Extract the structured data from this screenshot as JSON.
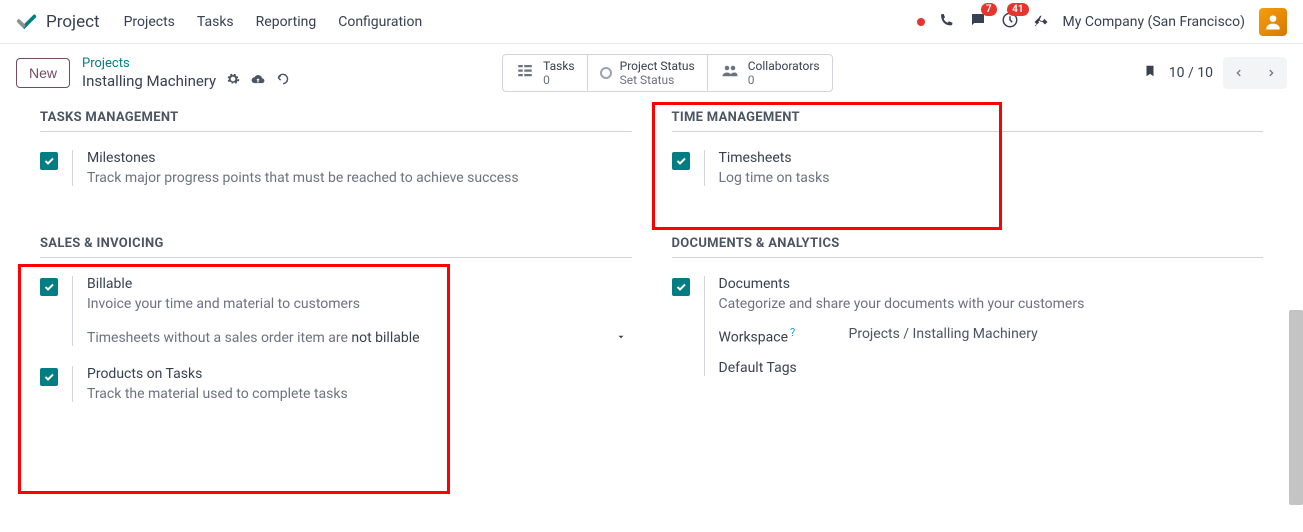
{
  "header": {
    "app_name": "Project",
    "menu": [
      "Projects",
      "Tasks",
      "Reporting",
      "Configuration"
    ],
    "chat_badge": "7",
    "activity_badge": "41",
    "company": "My Company (San Francisco)"
  },
  "controlbar": {
    "new_label": "New",
    "breadcrumb_parent": "Projects",
    "breadcrumb_current": "Installing Machinery",
    "stat_tasks_label": "Tasks",
    "stat_tasks_value": "0",
    "stat_status_label": "Project Status",
    "stat_status_value": "Set Status",
    "stat_collab_label": "Collaborators",
    "stat_collab_value": "0",
    "pager_text": "10 / 10"
  },
  "sections": {
    "tasks_mgmt": {
      "title": "TASKS MANAGEMENT",
      "milestones": {
        "title": "Milestones",
        "desc": "Track major progress points that must be reached to achieve success"
      }
    },
    "time_mgmt": {
      "title": "TIME MANAGEMENT",
      "timesheets": {
        "title": "Timesheets",
        "desc": "Log time on tasks"
      }
    },
    "sales": {
      "title": "SALES & INVOICING",
      "billable": {
        "title": "Billable",
        "desc": "Invoice your time and material to customers",
        "extra_prefix": "Timesheets without a sales order item are ",
        "extra_strong": "not billable"
      },
      "products": {
        "title": "Products on Tasks",
        "desc": "Track the material used to complete tasks"
      }
    },
    "docs": {
      "title": "DOCUMENTS & ANALYTICS",
      "documents": {
        "title": "Documents",
        "desc": "Categorize and share your documents with your customers"
      },
      "workspace_label": "Workspace",
      "workspace_value": "Projects / Installing Machinery",
      "tags_label": "Default Tags"
    }
  }
}
